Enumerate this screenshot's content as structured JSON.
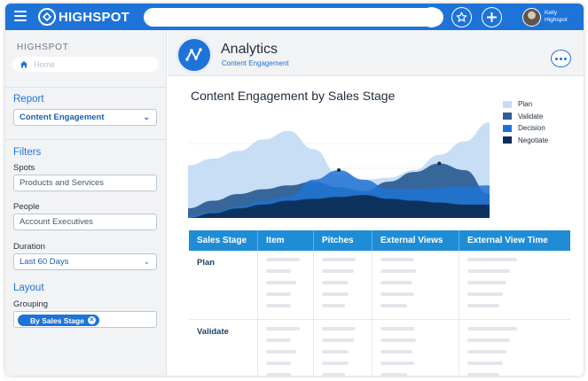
{
  "topbar": {
    "brand": "HIGHSPOT",
    "search_placeholder": "",
    "user_first": "Kelly",
    "user_last": "Highspot"
  },
  "sidebar": {
    "brand": "HIGHSPOT",
    "home_label": "Home",
    "report_heading": "Report",
    "report_value": "Content Engagement",
    "filters_heading": "Filters",
    "spots_label": "Spots",
    "spots_value": "Products and Services",
    "people_label": "People",
    "people_value": "Account Executives",
    "duration_label": "Duration",
    "duration_value": "Last 60 Days",
    "layout_heading": "Layout",
    "grouping_label": "Grouping",
    "grouping_chip": "By Sales Stage"
  },
  "main": {
    "title": "Analytics",
    "subtitle": "Content Engagement"
  },
  "chart_data": {
    "type": "area",
    "title": "Content Engagement by Sales Stage",
    "xlabel": "",
    "ylabel": "",
    "x": [
      0,
      1,
      2,
      3,
      4,
      5,
      6,
      7,
      8,
      9,
      10,
      11,
      12
    ],
    "ylim": [
      0,
      100
    ],
    "grid": true,
    "legend_position": "right",
    "series": [
      {
        "name": "Plan",
        "color": "#c5dcf4",
        "values": [
          55,
          62,
          70,
          82,
          91,
          72,
          45,
          40,
          42,
          50,
          66,
          80,
          100
        ]
      },
      {
        "name": "Validate",
        "color": "#2f5f96",
        "values": [
          10,
          18,
          25,
          30,
          34,
          38,
          32,
          28,
          38,
          48,
          57,
          50,
          25
        ]
      },
      {
        "name": "Decision",
        "color": "#1e73d2",
        "values": [
          2,
          6,
          12,
          18,
          22,
          40,
          50,
          40,
          30,
          30,
          32,
          33,
          34
        ]
      },
      {
        "name": "Negotiate",
        "color": "#0d2e57",
        "values": [
          0,
          5,
          10,
          14,
          18,
          20,
          22,
          24,
          20,
          18,
          16,
          14,
          14
        ]
      }
    ]
  },
  "table": {
    "headers": [
      "Sales Stage",
      "Item",
      "Pitches",
      "External Views",
      "External View Time"
    ],
    "rows": [
      {
        "stage": "Plan"
      },
      {
        "stage": "Validate"
      }
    ]
  }
}
